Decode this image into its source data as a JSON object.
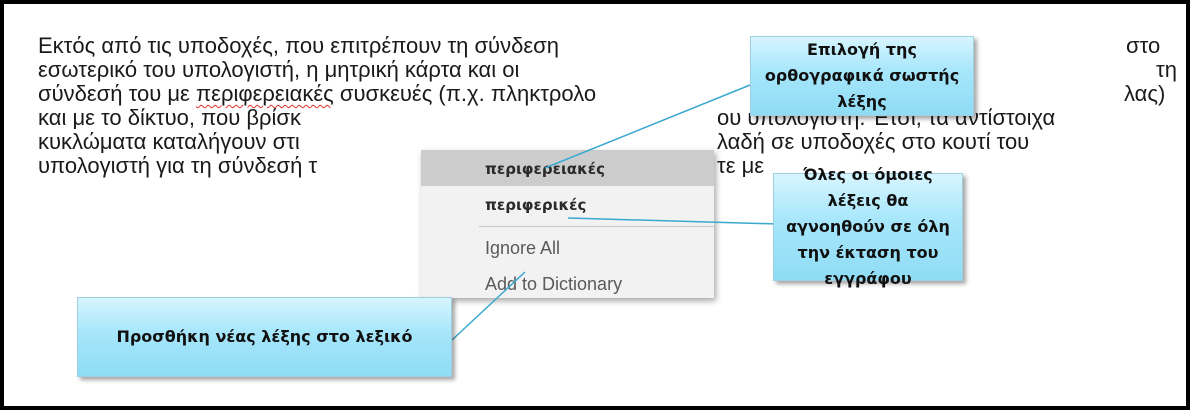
{
  "document": {
    "lines": [
      {
        "pre": "Εκτός από τις υποδοχές, που επιτρέπουν τη σύνδεση",
        "post": "στο"
      },
      {
        "pre": "εσωτερικό του υπολογιστή, η μητρική κάρτα και οι",
        "post": "τη"
      },
      {
        "pre": "σύνδεσή του με ",
        "mis": "περιφερειακές",
        "post": " συσκευές (π.χ. πληκτρολο",
        "tail": "λας)"
      },
      {
        "pre": "και με το δίκτυο, που βρίσκ",
        "post": "ου υπολογιστή. Έτσι, τα αντίστοιχα"
      },
      {
        "pre": "κυκλώματα καταλήγουν στι",
        "post": "λαδή σε υποδοχές στο κουτί του"
      },
      {
        "pre": "υπολογιστή για τη σύνδεσή τ",
        "post": "τε με"
      }
    ]
  },
  "context_menu": {
    "suggestions": [
      "περιφερειακές",
      "περιφερικές"
    ],
    "ignore_all": "Ignore All",
    "add_to_dictionary": "Add to Dictionary"
  },
  "callouts": {
    "correct_word": "Επιλογή της ορθογραφικά σωστής λέξης",
    "ignore_all": "Όλες οι όμοιες λέξεις θα αγνοηθούν σε όλη την έκταση του εγγράφου",
    "add_word": "Προσθήκη νέας λέξης στο λεξικό"
  },
  "colors": {
    "callout_fill": "#a6e6fb",
    "spell_underline": "#e03030",
    "menu_highlight": "#cccccc"
  }
}
